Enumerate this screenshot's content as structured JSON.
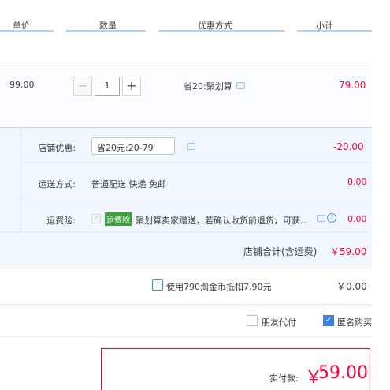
{
  "header": {
    "col_price": "单价",
    "col_qty": "数量",
    "col_promo": "优惠方式",
    "col_subtotal": "小计"
  },
  "item": {
    "unit_price": "99.00",
    "quantity": "1",
    "promo": "省20:聚划算",
    "subtotal": "79.00"
  },
  "shop": {
    "discount_label": "店铺优惠:",
    "discount_selected": "省20元:20-79",
    "discount_value": "-20.00",
    "shipping_label": "运送方式:",
    "shipping_value": "普通配送 快递 免邮",
    "shipping_cost": "0.00",
    "insurance_label": "运费险:",
    "insurance_tag": "运费险",
    "insurance_text": "聚划算卖家赠送，若确认收货前退货，可获...",
    "insurance_cost": "0.00",
    "total_label": "店铺合计(含运费)",
    "total_value": "￥59.00"
  },
  "coins": {
    "label": "使用790淘金币抵扣7.90元",
    "value": "￥0.00"
  },
  "options": {
    "friend_pay": "朋友代付",
    "anonymous": "匿名购买"
  },
  "payment": {
    "label": "实付款:",
    "currency": "￥",
    "amount": "59.00"
  },
  "colors": {
    "accent_red": "#ff0036",
    "accent_blue": "#3c7fe0",
    "insurance_green": "#3ba33a"
  }
}
